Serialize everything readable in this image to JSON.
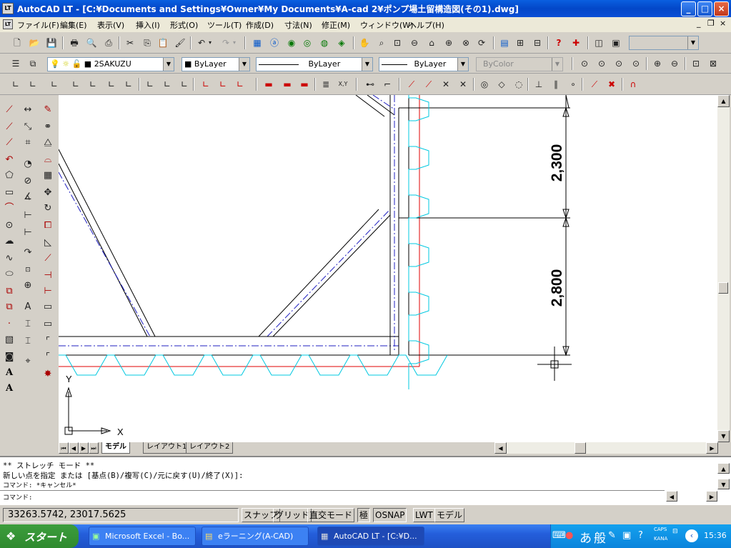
{
  "title": "AutoCAD LT - [C:¥Documents and Settings¥Owner¥My Documents¥A-cad 2¥ポンプ場土留構造図(その1).dwg]",
  "app_icon": "LT",
  "window_controls": {
    "min": "_",
    "max": "□",
    "close": "×"
  },
  "doc_controls": {
    "min": "_",
    "restore": "❐",
    "close": "×"
  },
  "menu": [
    "ファイル(F)",
    "編集(E)",
    "表示(V)",
    "挿入(I)",
    "形式(O)",
    "ツール(T)",
    "作成(D)",
    "寸法(N)",
    "修正(M)",
    "ウィンドウ(W)",
    "ヘルプ(H)"
  ],
  "toolbar2": {
    "layer": "2SAKUZU",
    "color": "ByLayer",
    "linetype": "ByLayer",
    "lineweight": "ByLayer",
    "plotstyle": "ByColor"
  },
  "drawing": {
    "dim_upper": "2,300",
    "dim_lower": "2,800",
    "axis_y": "Y",
    "axis_x": "X",
    "colors": {
      "cyan": "#00c8e0",
      "red": "#e00000",
      "blue": "#2020c0"
    }
  },
  "tabs": [
    "モデル",
    "レイアウト1",
    "レイアウト2"
  ],
  "command": {
    "line1": "** ストレッチ モード **",
    "line2": "新しい点を指定 または [基点(B)/複写(C)/元に戻す(U)/終了(X)]:",
    "line3": "コマンド: *キャンセル*",
    "line4": "コマンド:"
  },
  "status": {
    "coords": "33263.5742, 23017.5625",
    "snap": "スナップ",
    "grid": "グリッド",
    "ortho": "直交モード",
    "polar": "極",
    "osnap": "OSNAP",
    "lwt": "LWT",
    "model": "モデル"
  },
  "taskbar": {
    "start": "スタート",
    "tasks": [
      "Microsoft Excel - Bo...",
      "eラーニング(A-CAD)",
      "AutoCAD LT - [C:¥D..."
    ],
    "ime1": "あ",
    "ime2": "般",
    "caps": "CAPS",
    "kana": "KANA",
    "time": "15:36"
  }
}
